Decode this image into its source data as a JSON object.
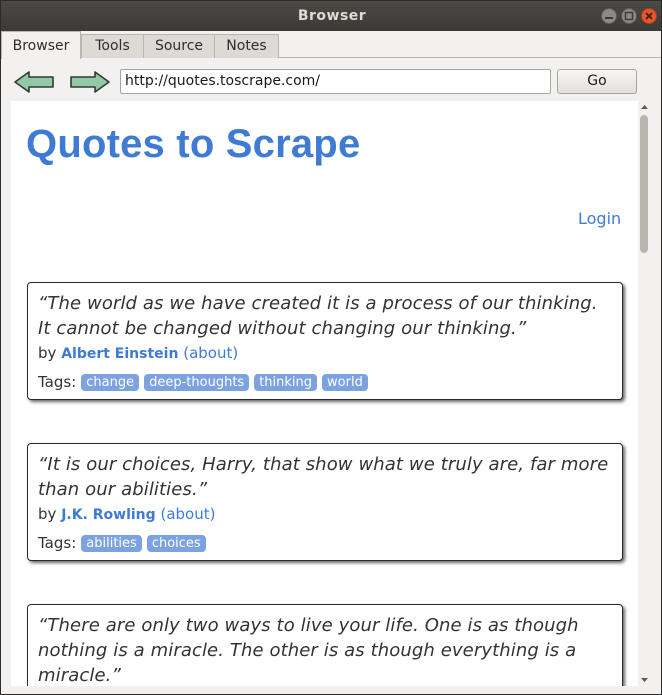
{
  "window": {
    "title": "Browser"
  },
  "tabs": [
    {
      "label": "Browser",
      "active": true
    },
    {
      "label": "Tools",
      "active": false
    },
    {
      "label": "Source",
      "active": false
    },
    {
      "label": "Notes",
      "active": false
    }
  ],
  "toolbar": {
    "back_icon": "left-arrow-icon",
    "forward_icon": "right-arrow-icon",
    "url": "http://quotes.toscrape.com/",
    "go_label": "Go"
  },
  "page": {
    "site_title": "Quotes to Scrape",
    "login_label": "Login",
    "link_color": "#3f7bd5",
    "tag_color": "#7ca3e0",
    "quotes": [
      {
        "text": "“The world as we have created it is a process of our thinking. It cannot be changed without changing our thinking.”",
        "by_label": "by",
        "author": "Albert Einstein",
        "about_label": "(about)",
        "tags_label": "Tags:",
        "tags": [
          "change",
          "deep-thoughts",
          "thinking",
          "world"
        ]
      },
      {
        "text": "“It is our choices, Harry, that show what we truly are, far more than our abilities.”",
        "by_label": "by",
        "author": "J.K. Rowling",
        "about_label": "(about)",
        "tags_label": "Tags:",
        "tags": [
          "abilities",
          "choices"
        ]
      },
      {
        "text": "“There are only two ways to live your life. One is as though nothing is a miracle. The other is as though everything is a miracle.”"
      }
    ]
  }
}
